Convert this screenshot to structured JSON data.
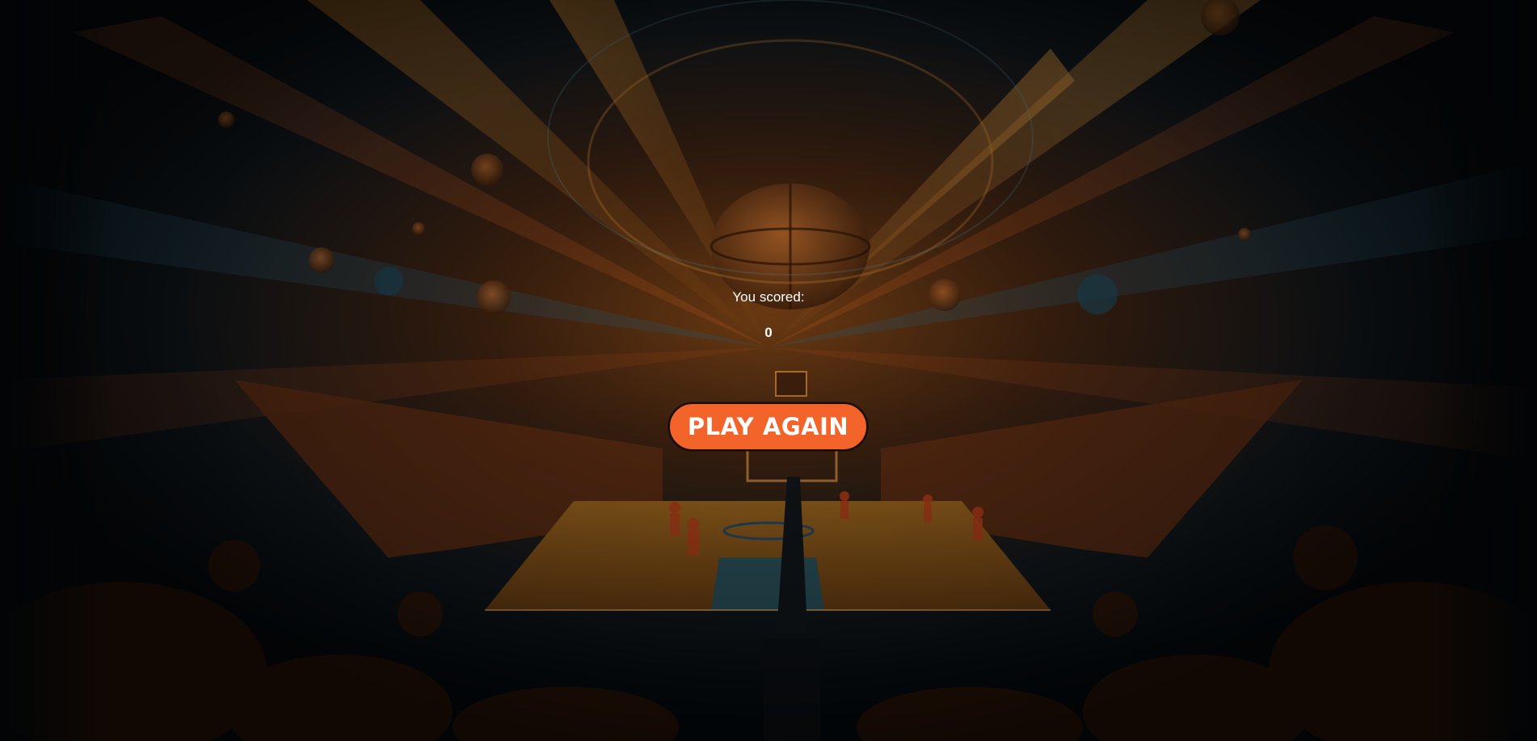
{
  "result": {
    "label": "You scored:",
    "score": "0"
  },
  "actions": {
    "play_again_label": "PLAY AGAIN"
  },
  "colors": {
    "accent": "#f2642a",
    "background": "#04090d",
    "text": "#ffffff"
  }
}
